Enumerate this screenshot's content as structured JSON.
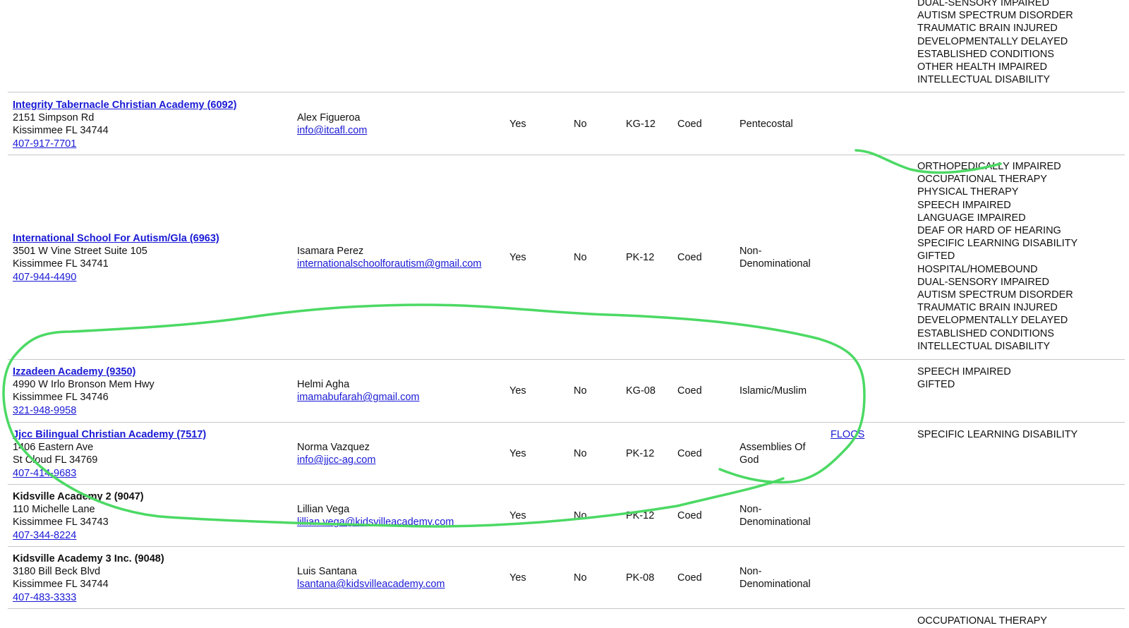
{
  "top_exceptionalities": [
    "DUAL-SENSORY IMPAIRED",
    "AUTISM SPECTRUM DISORDER",
    "TRAUMATIC BRAIN INJURED",
    "DEVELOPMENTALLY DELAYED",
    "ESTABLISHED CONDITIONS",
    "OTHER HEALTH IMPAIRED",
    "INTELLECTUAL DISABILITY"
  ],
  "schools": [
    {
      "name": "Integrity Tabernacle Christian Academy (6092)",
      "address1": "2151 Simpson Rd",
      "address2": "Kissimmee FL 34744",
      "phone": "407-917-7701",
      "contact": "Alex Figueroa",
      "email": "info@itcafl.com",
      "col_a": "Yes",
      "col_b": "No",
      "grades": "KG-12",
      "gender": "Coed",
      "religion": "Pentecostal",
      "religion2": "",
      "accreditation": "",
      "exceptionalities": []
    },
    {
      "name": "International School For Autism/Gla (6963)",
      "address1": "3501 W Vine Street Suite 105",
      "address2": "Kissimmee FL 34741",
      "phone": "407-944-4490",
      "contact": "Isamara Perez",
      "email": "internationalschoolforautism@gmail.com",
      "col_a": "Yes",
      "col_b": "No",
      "grades": "PK-12",
      "gender": "Coed",
      "religion": "Non-",
      "religion2": "Denominational",
      "accreditation": "",
      "exceptionalities": [
        "ORTHOPEDICALLY IMPAIRED",
        "OCCUPATIONAL THERAPY",
        "PHYSICAL THERAPY",
        "SPEECH IMPAIRED",
        "LANGUAGE IMPAIRED",
        "DEAF OR HARD OF HEARING",
        "SPECIFIC LEARNING DISABILITY",
        "GIFTED",
        "HOSPITAL/HOMEBOUND",
        "DUAL-SENSORY IMPAIRED",
        "AUTISM SPECTRUM DISORDER",
        "TRAUMATIC BRAIN INJURED",
        "DEVELOPMENTALLY DELAYED",
        "ESTABLISHED CONDITIONS",
        "INTELLECTUAL DISABILITY"
      ]
    },
    {
      "name": "Izzadeen Academy (9350)",
      "address1": "4990 W Irlo Bronson Mem Hwy",
      "address2": "Kissimmee FL 34746",
      "phone": "321-948-9958",
      "contact": "Helmi Agha",
      "email": "imamabufarah@gmail.com",
      "col_a": "Yes",
      "col_b": "No",
      "grades": "KG-08",
      "gender": "Coed",
      "religion": "Islamic/Muslim",
      "religion2": "",
      "accreditation": "",
      "exceptionalities": [
        "SPEECH IMPAIRED",
        "GIFTED"
      ]
    },
    {
      "name": "Jjcc Bilingual Christian Academy (7517)",
      "address1": "1406 Eastern Ave",
      "address2": "St Cloud FL 34769",
      "phone": "407-414-9683",
      "contact": "Norma Vazquez",
      "email": "info@jjcc-ag.com",
      "col_a": "Yes",
      "col_b": "No",
      "grades": "PK-12",
      "gender": "Coed",
      "religion": "Assemblies Of",
      "religion2": "God",
      "accreditation": "FLOCS",
      "exceptionalities": [
        "SPECIFIC LEARNING DISABILITY"
      ]
    },
    {
      "name": "Kidsville Academy 2 (9047)",
      "address1": "110 Michelle Lane",
      "address2": "Kissimmee FL 34743",
      "phone": "407-344-8224",
      "contact": "Lillian Vega",
      "email": "lillian.vega@kidsvilleacademy.com",
      "col_a": "Yes",
      "col_b": "No",
      "grades": "PK-12",
      "gender": "Coed",
      "religion": "Non-",
      "religion2": "Denominational",
      "accreditation": "",
      "exceptionalities": []
    },
    {
      "name": "Kidsville Academy 3 Inc. (9048)",
      "address1": "3180 Bill Beck Blvd",
      "address2": "Kissimmee FL 34744",
      "phone": "407-483-3333",
      "contact": "Luis Santana",
      "email": "lsantana@kidsvilleacademy.com",
      "col_a": "Yes",
      "col_b": "No",
      "grades": "PK-08",
      "gender": "Coed",
      "religion": "Non-",
      "religion2": "Denominational",
      "accreditation": "",
      "exceptionalities": []
    }
  ],
  "bottom_exceptionalities": [
    "OCCUPATIONAL THERAPY"
  ],
  "annotation": {
    "stroke_color": "#4cd964"
  }
}
